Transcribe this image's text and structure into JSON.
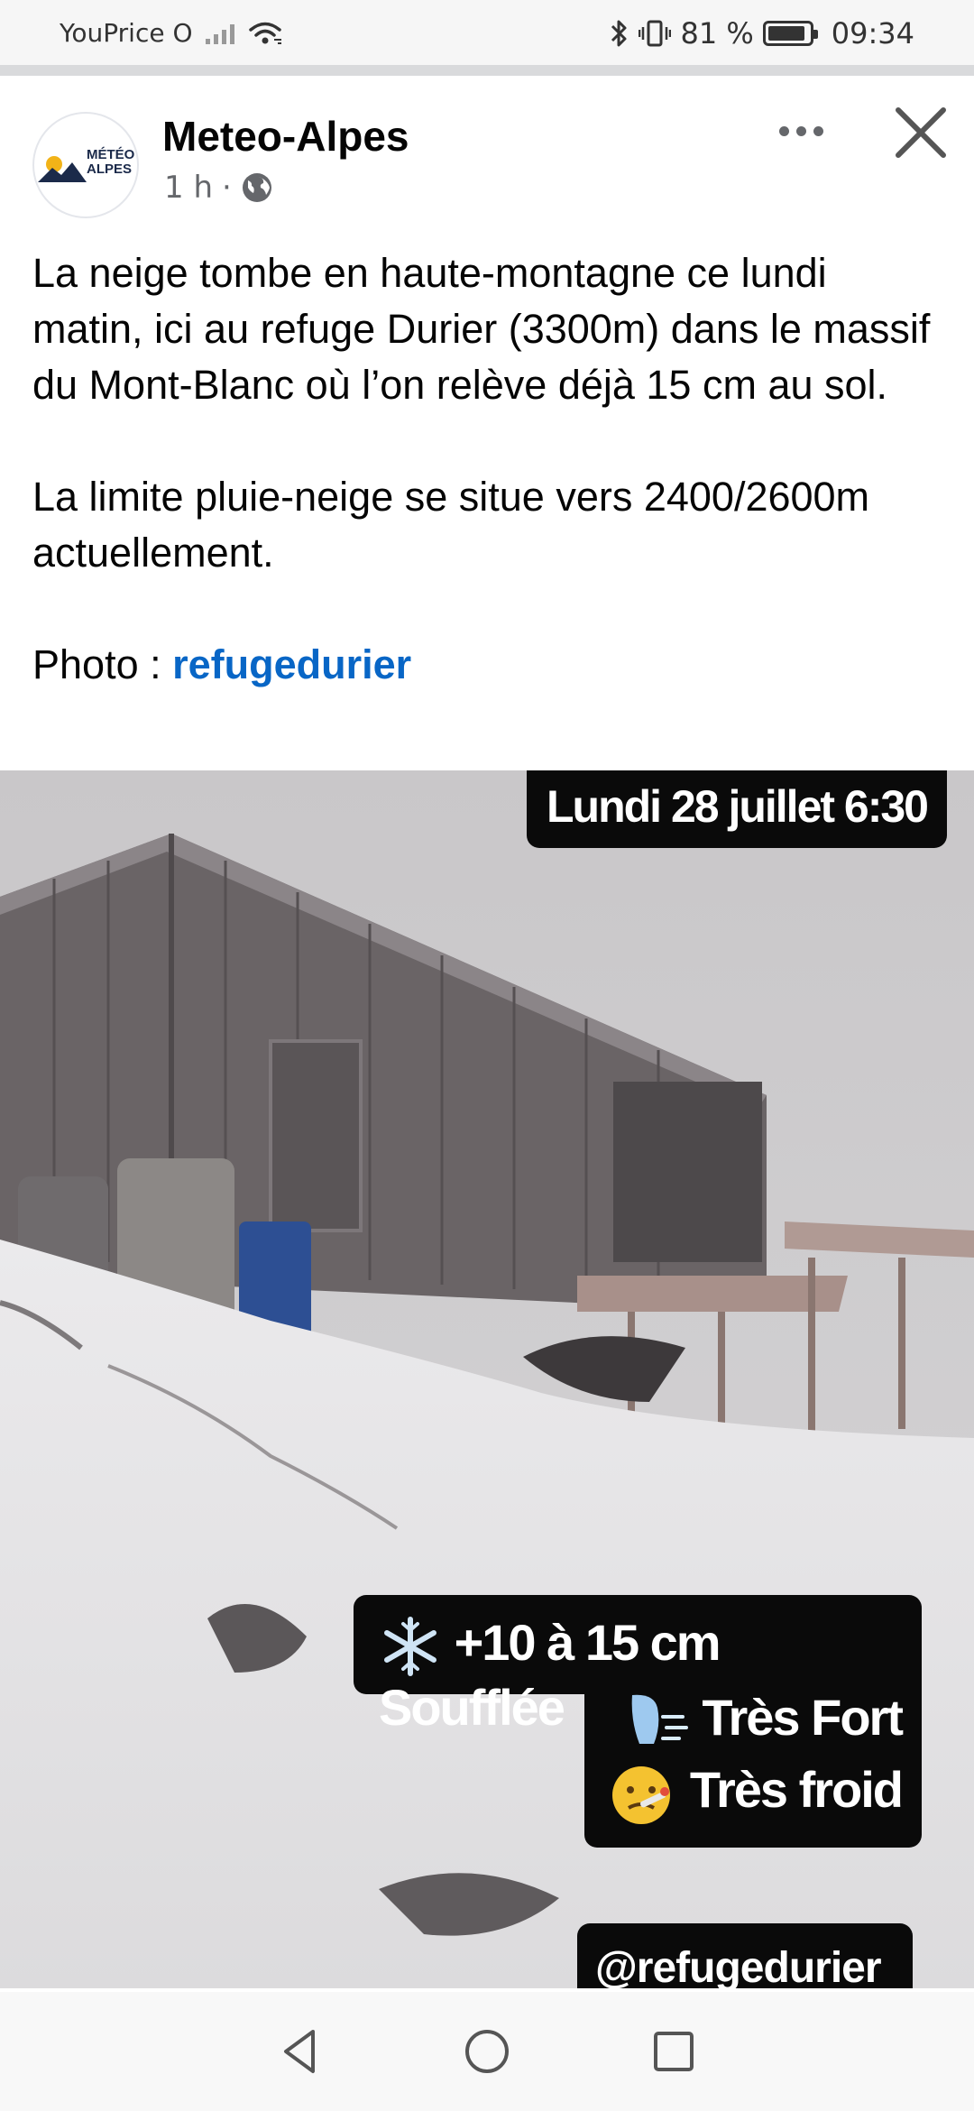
{
  "status_bar": {
    "carrier": "YouPrice O",
    "battery": "81 %",
    "time": "09:34"
  },
  "post": {
    "page_name": "Meteo-Alpes",
    "time_ago": "1 h",
    "separator": "·",
    "avatar_logo": {
      "line1": "MÉTÉO",
      "line2": "ALPES"
    },
    "paragraph1": "La neige tombe en haute-montagne ce lundi matin, ici au refuge Durier (3300m) dans le massif du Mont-Blanc où l’on relève déjà 15 cm au sol.",
    "paragraph2": "La limite pluie-neige se situe vers 2400/2600m actuellement.",
    "photo_credit_label": "Photo : ",
    "photo_credit_link": "refugedurier"
  },
  "photo": {
    "date_tag": "Lundi 28 juillet 6:30",
    "snow_stat": "+10 à 15 cm Soufflée",
    "wind_stat": "Très Fort",
    "temp_stat": "Très froid",
    "handle": "@refugedurier",
    "icons": [
      "snowflake-icon",
      "wind-face-icon",
      "cold-face-icon"
    ]
  },
  "colors": {
    "link": "#0866c6",
    "secondary_text": "#65676b",
    "overlay_bg": "#0a0a0a"
  }
}
